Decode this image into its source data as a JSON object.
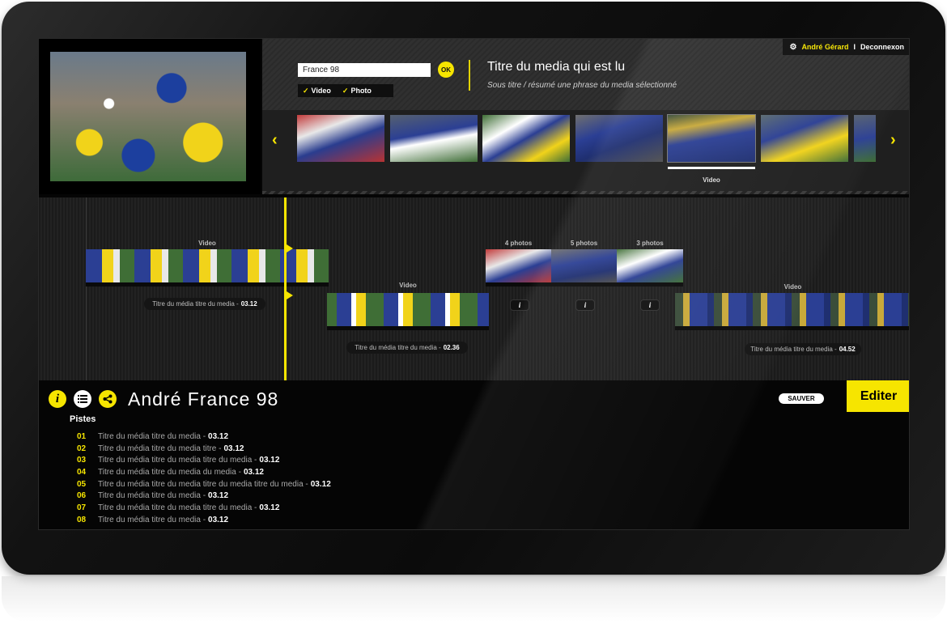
{
  "user": {
    "name": "André Gérard",
    "separator": "I",
    "logout": "Deconnexon"
  },
  "search": {
    "value": "France 98",
    "ok_label": "OK"
  },
  "filters": [
    {
      "label": "Video"
    },
    {
      "label": "Photo"
    }
  ],
  "media": {
    "title": "Titre du media qui est lu",
    "subtitle": "Sous titre / résumé une phrase du media sélectionné"
  },
  "strip": {
    "selected_caption": "Video"
  },
  "timeline": {
    "clip1": {
      "label": "Video",
      "caption": "Titre du média titre du media -",
      "duration": "03.12"
    },
    "clip2": {
      "label": "Video",
      "caption": "Titre du média titre du media -",
      "duration": "02.36"
    },
    "photos": [
      {
        "label": "4 photos"
      },
      {
        "label": "5 photos"
      },
      {
        "label": "3 photos"
      }
    ],
    "info_label": "i",
    "clip3": {
      "label": "Video",
      "caption": "Titre du média titre du media -",
      "duration": "04.52"
    }
  },
  "project": {
    "title": "André France 98",
    "save_label": "SAUVER",
    "edit_label": "Editer",
    "tracks_title": "Pistes"
  },
  "tracks": [
    {
      "num": "01",
      "title": "Titre du média titre du media -",
      "duration": "03.12"
    },
    {
      "num": "02",
      "title": "Titre du média titre du media titre -",
      "duration": "03.12"
    },
    {
      "num": "03",
      "title": "Titre du média titre du media titre du media -",
      "duration": "03.12"
    },
    {
      "num": "04",
      "title": "Titre du média titre du media du media -",
      "duration": "03.12"
    },
    {
      "num": "05",
      "title": "Titre du média titre du media titre du media titre du media -",
      "duration": "03.12"
    },
    {
      "num": "06",
      "title": "Titre du média titre du media -",
      "duration": "03.12"
    },
    {
      "num": "07",
      "title": "Titre du média titre du media titre du media -",
      "duration": "03.12"
    },
    {
      "num": "08",
      "title": "Titre du média titre du media -",
      "duration": "03.12"
    }
  ],
  "colors": {
    "accent": "#f6e500",
    "background": "#050505",
    "panel": "#2a2a2a",
    "text": "#ffffff"
  },
  "icons": {
    "prev": "chevron-left-icon",
    "next": "chevron-right-icon",
    "settings": "gear-icon",
    "info": "info-icon",
    "list": "list-icon",
    "share": "share-icon",
    "check": "check-icon"
  }
}
